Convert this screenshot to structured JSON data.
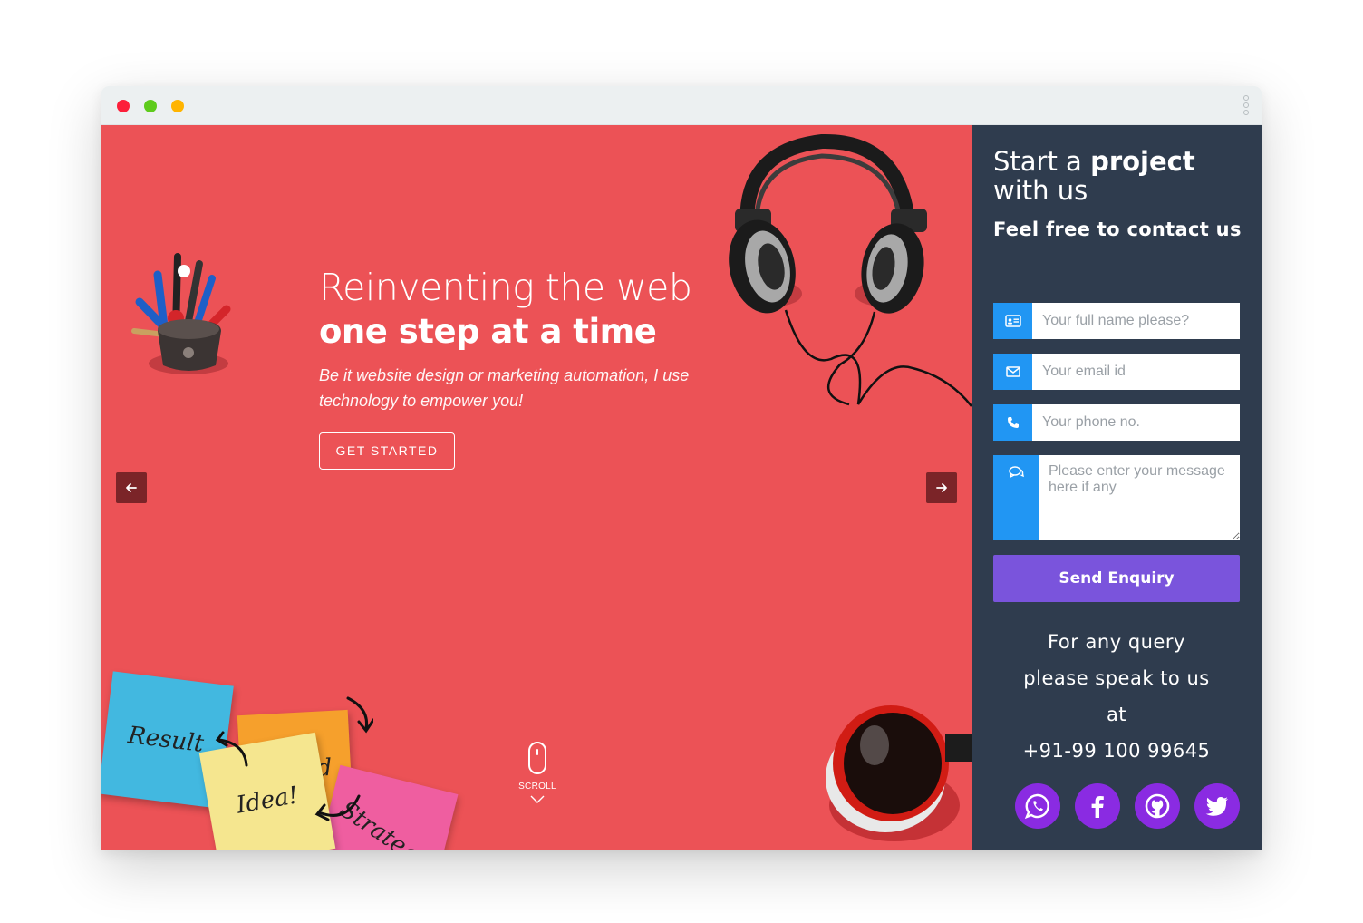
{
  "hero": {
    "title_light": "Reinventing the web",
    "title_bold": "one step at a time",
    "subtitle": "Be it website design or marketing automation, I use technology to empower you!",
    "cta_label": "GET STARTED",
    "scroll_label": "SCROLL",
    "background_color": "#ec5256"
  },
  "notes": {
    "brand": "Brand",
    "result": "Result",
    "strategy": "Strategy",
    "idea": "Idea!"
  },
  "sidebar": {
    "title_plain": "Start a ",
    "title_bold": "project",
    "title_rest": "with us",
    "subtitle": "Feel free to contact us",
    "form": {
      "name_placeholder": "Your full name please?",
      "email_placeholder": "Your email id",
      "phone_placeholder": "Your phone no.",
      "message_placeholder": "Please enter your message here if any",
      "send_label": "Send Enquiry"
    },
    "query_lines": [
      "For any query",
      "please speak to us",
      "at",
      "+91-99 100 99645"
    ],
    "social": [
      "whatsapp-icon",
      "facebook-icon",
      "github-icon",
      "twitter-icon"
    ],
    "background_color": "#2f3c4e",
    "accent_color": "#2196f3",
    "button_color": "#7a54dc"
  }
}
